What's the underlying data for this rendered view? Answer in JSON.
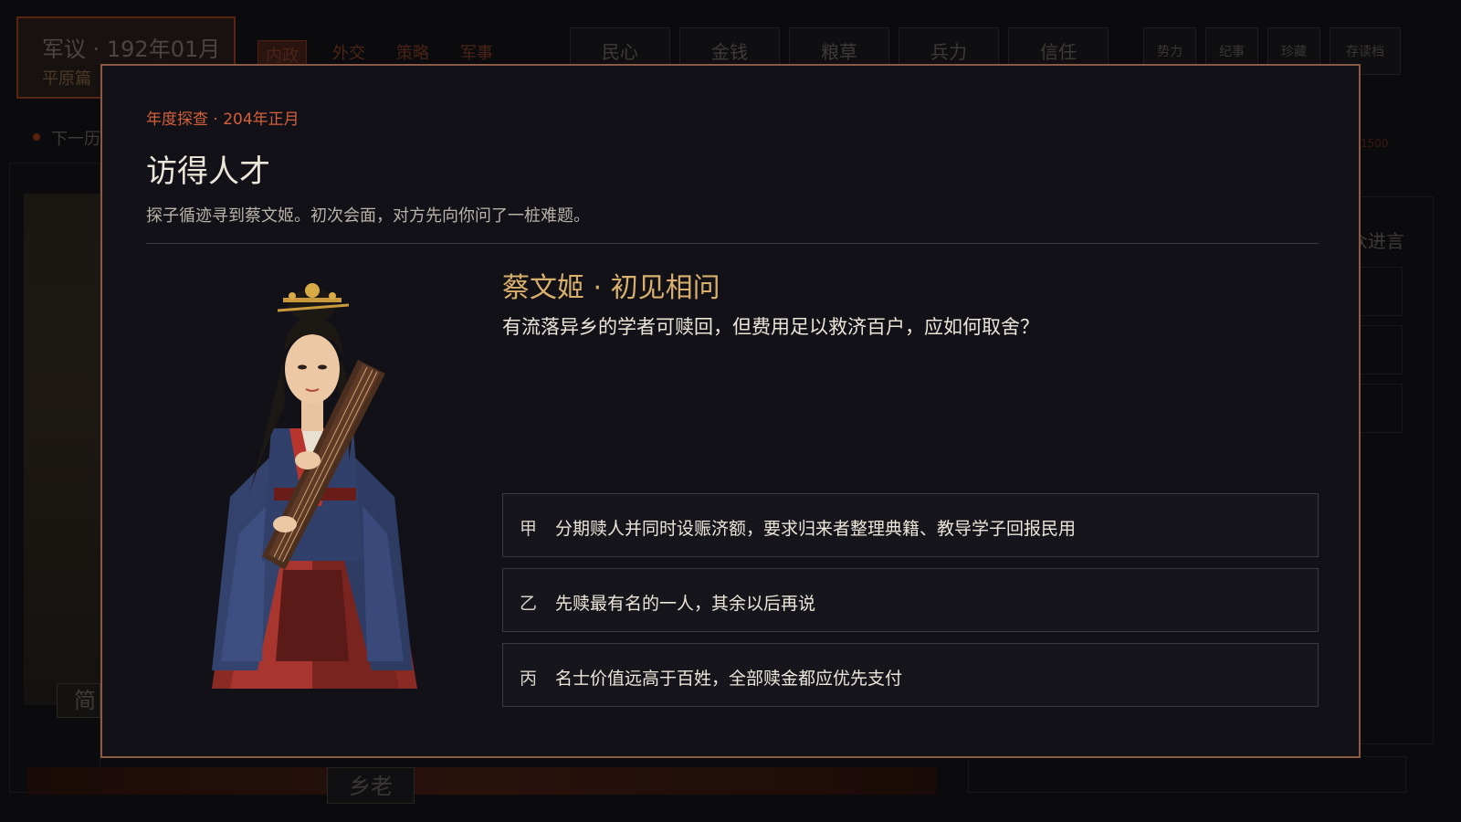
{
  "background": {
    "header": {
      "title": "军议 · 192年01月",
      "subtitle": "平原篇"
    },
    "tabs": [
      "内政",
      "外交",
      "策略",
      "军事"
    ],
    "stats": [
      "民心",
      "金钱",
      "粮草",
      "兵力",
      "信任"
    ],
    "buttons": [
      "势力",
      "纪事",
      "珍藏",
      "存读档"
    ],
    "next_label": "下一历",
    "right_value": "1500",
    "right_text": "众进言",
    "left_label": "简",
    "bottom_label": "乡老"
  },
  "modal": {
    "kicker": "年度探查 · 204年正月",
    "title": "访得人才",
    "description": "探子循迹寻到蔡文姬。初次会面，对方先向你问了一桩难题。",
    "portrait_name": "蔡文姬",
    "question_title": "蔡文姬 · 初见相问",
    "question_text": "有流落异乡的学者可赎回，但费用足以救济百户，应如何取舍？",
    "options": [
      {
        "mark": "甲",
        "text": "分期赎人并同时设赈济额，要求归来者整理典籍、教导学子回报民用"
      },
      {
        "mark": "乙",
        "text": "先赎最有名的一人，其余以后再说"
      },
      {
        "mark": "丙",
        "text": "名士价值远高于百姓，全部赎金都应优先支付"
      }
    ]
  },
  "colors": {
    "modal_bg": "#121117",
    "modal_border": "#8a5a44",
    "kicker": "#d2603c",
    "question_title": "#d8b06c"
  }
}
